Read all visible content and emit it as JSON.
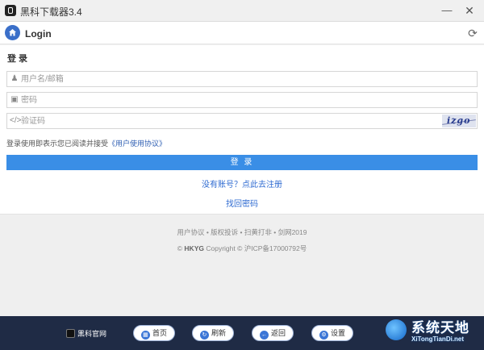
{
  "window": {
    "title": "黑科下载器3.4",
    "minimize_glyph": "—",
    "close_glyph": "✕"
  },
  "header": {
    "title": "Login",
    "home_icon": "home-icon",
    "refresh_icon": "refresh-icon",
    "refresh_glyph": "⟳"
  },
  "login": {
    "section_title": "登 录",
    "username_placeholder": "用户名/邮箱",
    "password_placeholder": "密码",
    "captcha_placeholder": "验证码",
    "captcha_text": "izgo",
    "agreement_text": "登录使用即表示您已阅读并接受",
    "agreement_link": "《用户使用协议》",
    "submit_label": "登 录",
    "register_link": "没有账号？点此去注册",
    "recover_link": "找回密码"
  },
  "footer": {
    "links": "用户协议 • 版权投诉 • 扫黄打非 • 剑网2019",
    "copyright_symbol": "©",
    "brand": "HKYG",
    "copyright": "Copyright © 沪ICP备17000792号"
  },
  "bottombar": {
    "site_label": "黑科官网",
    "home_label": "首页",
    "refresh_label": "刷新",
    "back_label": "返回",
    "settings_label": "设置"
  },
  "watermark": {
    "big": "系统天地",
    "small": "XiTongTianDi.net"
  },
  "colors": {
    "accent": "#3a8ee6",
    "link": "#2f6bd1",
    "bottombar": "#1f2b45",
    "home_button": "#3a6fc9"
  }
}
